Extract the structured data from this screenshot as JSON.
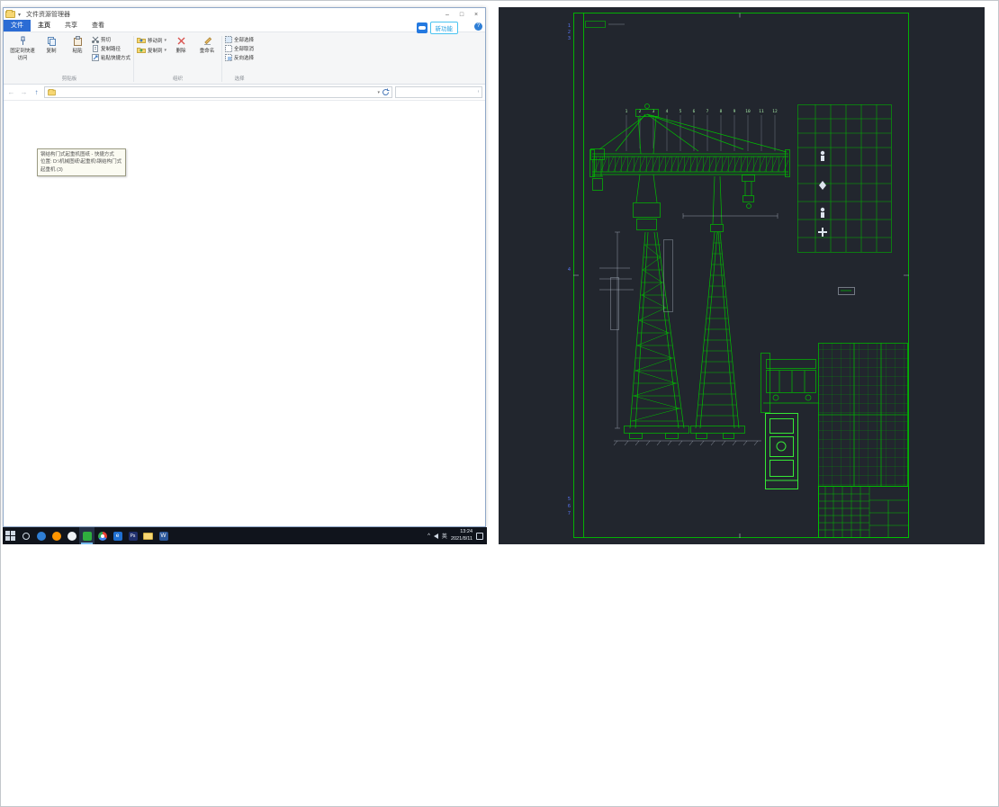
{
  "explorer": {
    "title": "文件资源管理器",
    "controls": {
      "minimize": "–",
      "maximize": "□",
      "close": "×"
    },
    "tabs": {
      "file": "文件",
      "home": "主页",
      "share": "共享",
      "view": "查看"
    },
    "promo": {
      "label": "新功能"
    },
    "help": "?",
    "ribbon": {
      "pin_quick": "固定到快速访问",
      "copy": "复制",
      "paste": "粘贴",
      "cut": "剪切",
      "copy_path": "复制路径",
      "paste_shortcut": "粘贴快捷方式",
      "move_to": "移动到",
      "copy_to": "复制到",
      "delete": "删除",
      "rename": "重命名",
      "select_all": "全部选择",
      "select_none": "全部取消",
      "invert": "反向选择",
      "groups": {
        "clipboard": "剪贴板",
        "organize": "组织",
        "select": "选择"
      }
    },
    "nav": {
      "icons": {
        "back": "←",
        "forward": "→",
        "up": "↑",
        "caret": "▾"
      }
    },
    "address": {
      "value": ""
    },
    "search": {
      "value": ""
    },
    "tooltip": {
      "line1": "钢结构门式起重机图纸 - 快捷方式",
      "line2": "位置: D:\\机械图纸\\起重机\\钢结构门式起重机 (3)"
    }
  },
  "taskbar": {
    "icons": [
      "start",
      "search",
      "edge",
      "firefox",
      "qq",
      "wechat",
      "chrome",
      "ie",
      "photoshop",
      "explorer",
      "word"
    ],
    "glyphs": {
      "word": "W",
      "ie": "e",
      "ps": "Ps"
    },
    "tray": {
      "chevron": "^",
      "lang": "英",
      "time": "13:24",
      "date": "2021/8/11"
    }
  },
  "cad": {
    "zones_top": [
      "1",
      "2",
      "3"
    ],
    "zone_mid": "4",
    "zones_bottom": [
      "5",
      "6",
      "7"
    ],
    "callouts": [
      "1",
      "2",
      "3",
      "4",
      "5",
      "6",
      "7",
      "8",
      "9",
      "10",
      "11",
      "12"
    ]
  }
}
